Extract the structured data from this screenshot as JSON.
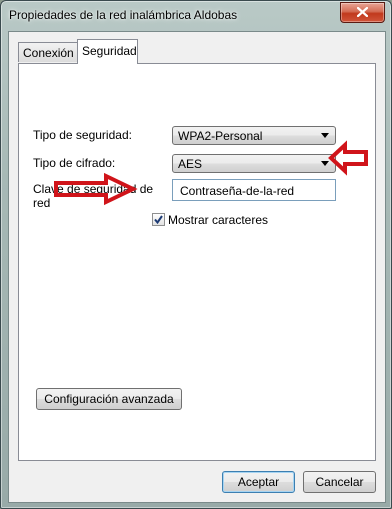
{
  "window": {
    "title": "Propiedades de la red inalámbrica Aldobas"
  },
  "tabs": [
    {
      "label": "Conexión",
      "active": false
    },
    {
      "label": "Seguridad",
      "active": true
    }
  ],
  "security": {
    "security_type_label": "Tipo de seguridad:",
    "security_type_value": "WPA2-Personal",
    "encryption_type_label": "Tipo de cifrado:",
    "encryption_type_value": "AES",
    "key_label_line1": "Clave de seguridad de",
    "key_label_line2": "red",
    "key_value": "Contraseña-de-la-red",
    "show_chars_label": "Mostrar caracteres",
    "show_chars_checked": true,
    "advanced_button": "Configuración avanzada"
  },
  "footer": {
    "ok_label": "Aceptar",
    "cancel_label": "Cancelar"
  },
  "colors": {
    "annotation_arrow": "#d0141a"
  }
}
